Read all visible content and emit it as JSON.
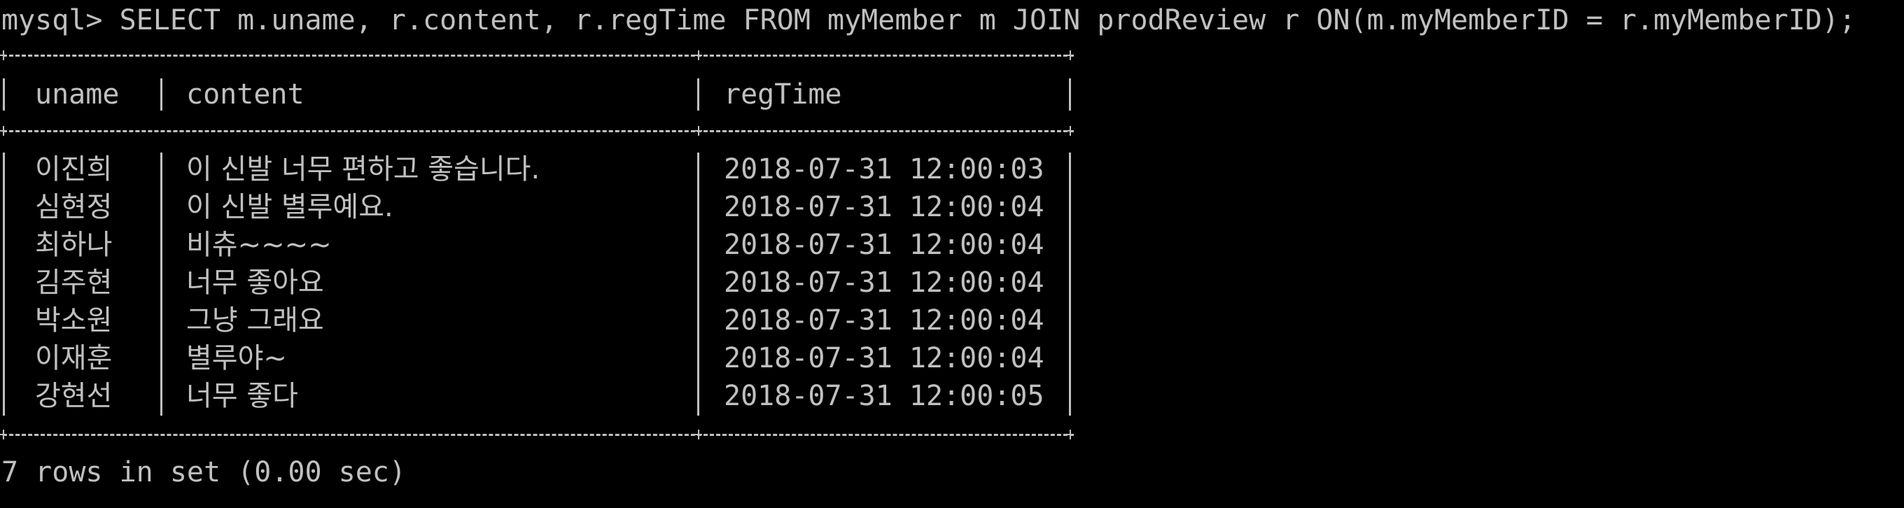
{
  "terminal": {
    "command_line": "mysql> SELECT m.uname, r.content, r.regTime FROM myMember m JOIN prodReview r ON(m.myMemberID = r.myMemberID);",
    "columns": [
      "uname",
      "content",
      "regTime"
    ],
    "rows": [
      {
        "uname": "이진희",
        "content": "이 신발 너무 편하고 좋습니다.",
        "regTime": "2018-07-31 12:00:03"
      },
      {
        "uname": "심현정",
        "content": "이 신발 별루예요.",
        "regTime": "2018-07-31 12:00:04"
      },
      {
        "uname": "최하나",
        "content": "비츄~~~~",
        "regTime": "2018-07-31 12:00:04"
      },
      {
        "uname": "김주현",
        "content": "너무 좋아요",
        "regTime": "2018-07-31 12:00:04"
      },
      {
        "uname": "박소원",
        "content": "그냥 그래요",
        "regTime": "2018-07-31 12:00:04"
      },
      {
        "uname": "이재훈",
        "content": "별루야~",
        "regTime": "2018-07-31 12:00:04"
      },
      {
        "uname": "강현선",
        "content": "너무 좋다",
        "regTime": "2018-07-31 12:00:05"
      }
    ],
    "summary": "7 rows in set (0.00 sec)"
  },
  "colors": {
    "background": "#000000",
    "text": "#c0c0c0"
  }
}
